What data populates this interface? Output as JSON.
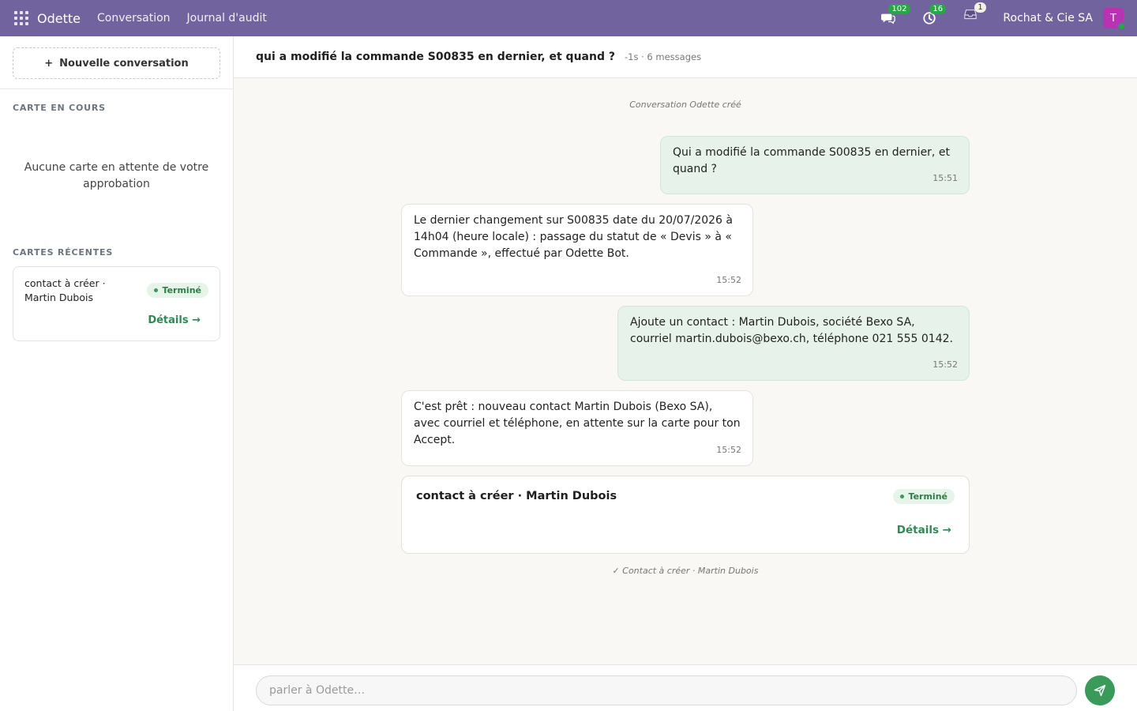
{
  "navbar": {
    "brand": "Odette",
    "menu": [
      "Conversation",
      "Journal d'audit"
    ],
    "messages_count": "102",
    "activities_count": "16",
    "alerts_count": "1",
    "company": "Rochat & Cie SA",
    "avatar_letter": "T",
    "colors": {
      "bar": "#71639e",
      "badge": "#28a745",
      "avatar": "#b832b3"
    }
  },
  "sidebar": {
    "new_conversation": "Nouvelle conversation",
    "current_section": "CARTE EN COURS",
    "empty_message": "Aucune carte en attente de votre approbation",
    "recent_section": "CARTES RÉCENTES",
    "recent_card": {
      "title": "contact à créer · Martin Dubois",
      "status": "Terminé",
      "details": "Détails →"
    }
  },
  "conversation": {
    "title": "qui a modifié la commande S00835 en dernier, et quand ?",
    "meta": "-1s · 6 messages",
    "created_note": "Conversation Odette créé",
    "messages": [
      {
        "role": "user",
        "text": "Qui a modifié la commande S00835 en dernier, et quand ?",
        "time": "15:51"
      },
      {
        "role": "bot",
        "text": "Le dernier changement sur S00835 date du 20/07/2026 à 14h04 (heure locale) : passage du statut de « Devis » à « Commande », effectué par Odette Bot.",
        "time": "15:52"
      },
      {
        "role": "user",
        "text": "Ajoute un contact : Martin Dubois, société Bexo SA, courriel martin.dubois@bexo.ch, téléphone 021 555 0142.",
        "time": "15:52"
      },
      {
        "role": "bot",
        "text": "C'est prêt : nouveau contact Martin Dubois (Bexo SA), avec courriel et téléphone, en attente sur la carte pour ton Accept.",
        "time": "15:52"
      }
    ],
    "card": {
      "title": "contact à créer · Martin Dubois",
      "status": "Terminé",
      "details": "Détails →"
    },
    "done_note": "✓ Contact à créer · Martin Dubois"
  },
  "composer": {
    "placeholder": "parler à Odette…"
  },
  "colors": {
    "user_bubble": "#e7f3ea",
    "accent_green": "#3a9a5a",
    "background": "#f9f8f5"
  }
}
